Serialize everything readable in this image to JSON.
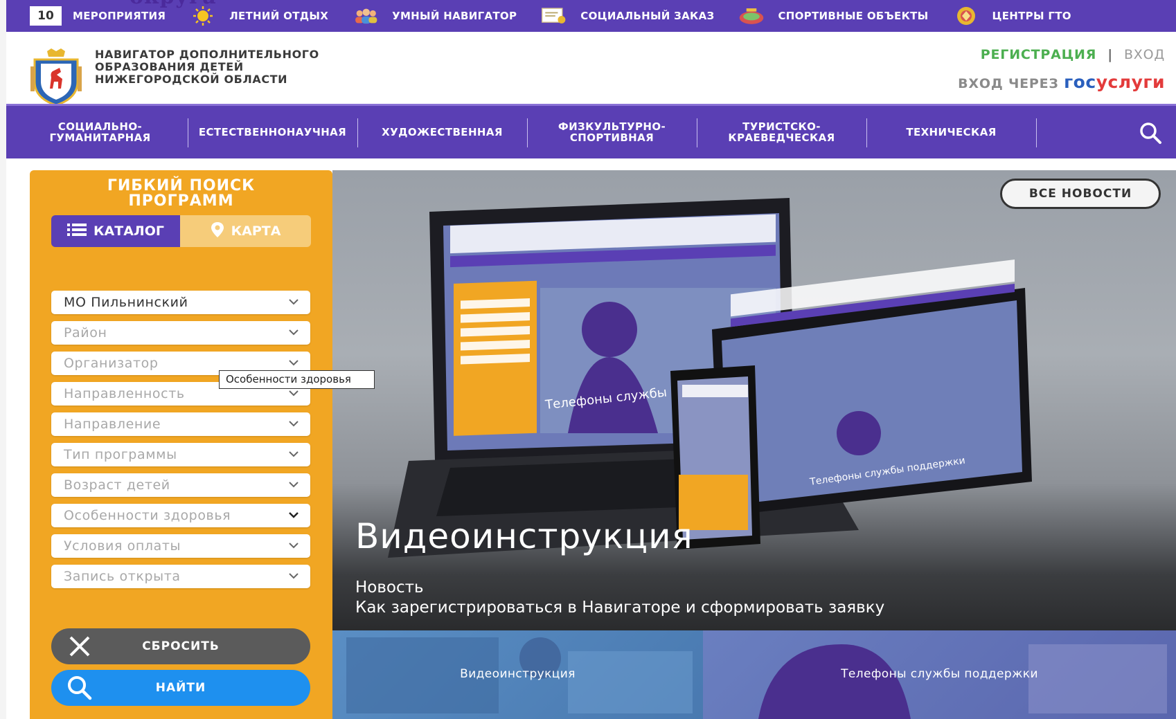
{
  "top_fragment": "округа",
  "topbar": {
    "badge": "10",
    "items": [
      {
        "label": "МЕРОПРИЯТИЯ",
        "icon": "none"
      },
      {
        "label": "ЛЕТНИЙ ОТДЫХ",
        "icon": "sun-icon"
      },
      {
        "label": "УМНЫЙ НАВИГАТОР",
        "icon": "people-icon"
      },
      {
        "label": "СОЦИАЛЬНЫЙ ЗАКАЗ",
        "icon": "certificate-icon"
      },
      {
        "label": "СПОРТИВНЫЕ ОБЪЕКТЫ",
        "icon": "stadium-icon"
      },
      {
        "label": "ЦЕНТРЫ ГТО",
        "icon": "gto-badge-icon"
      }
    ]
  },
  "header": {
    "brand_line1": "НАВИГАТОР ДОПОЛНИТЕЛЬНОГО",
    "brand_line2": "ОБРАЗОВАНИЯ ДЕТЕЙ",
    "brand_line3": "НИЖЕГОРОДСКОЙ ОБЛАСТИ",
    "register": "РЕГИСТРАЦИЯ",
    "separator": "|",
    "login": "ВХОД",
    "gos_prefix": "ВХОД ЧЕРЕЗ",
    "gos_part1": "гос",
    "gos_part2": "услуги"
  },
  "categories": [
    {
      "line1": "СОЦИАЛЬНО-",
      "line2": "ГУМАНИТАРНАЯ"
    },
    {
      "line1": "ЕСТЕСТВЕННОНАУЧНАЯ",
      "line2": ""
    },
    {
      "line1": "ХУДОЖЕСТВЕННАЯ",
      "line2": ""
    },
    {
      "line1": "ФИЗКУЛЬТУРНО-",
      "line2": "СПОРТИВНАЯ"
    },
    {
      "line1": "ТУРИСТСКО-",
      "line2": "КРАЕВЕДЧЕСКАЯ"
    },
    {
      "line1": "ТЕХНИЧЕСКАЯ",
      "line2": ""
    }
  ],
  "search_panel": {
    "title_line1": "ГИБКИЙ ПОИСК",
    "title_line2": "ПРОГРАММ",
    "catalog_label": "КАТАЛОГ",
    "map_label": "КАРТА",
    "filters": [
      {
        "value": "МО Пильнинский",
        "selected": true
      },
      {
        "value": "Район",
        "selected": false
      },
      {
        "value": "Организатор",
        "selected": false
      },
      {
        "value": "Направленность",
        "selected": false
      },
      {
        "value": "Направление",
        "selected": false
      },
      {
        "value": "Тип программы",
        "selected": false
      },
      {
        "value": "Возраст детей",
        "selected": false
      },
      {
        "value": "Особенности здоровья",
        "selected": false
      },
      {
        "value": "Условия оплаты",
        "selected": false
      },
      {
        "value": "Запись открыта",
        "selected": false
      }
    ],
    "tooltip": "Особенности здоровья",
    "reset_label": "СБРОСИТЬ",
    "find_label": "НАЙТИ"
  },
  "hero": {
    "all_news": "ВСЕ НОВОСТИ",
    "title": "Видеоинструкция",
    "kicker": "Новость",
    "description": "Как зарегистрироваться в Навигаторе и сформировать заявку",
    "screen_caption_1": "Телефоны службы по",
    "screen_caption_2": "Телефоны службы поддержки"
  },
  "thumbnails": [
    {
      "label": "Видеоинструкция"
    },
    {
      "label": "Телефоны службы поддержки"
    }
  ],
  "colors": {
    "brand_purple": "#5a3fb4",
    "panel_orange": "#f1a623",
    "register_green": "#4caf50",
    "find_blue": "#1e90ef",
    "reset_gray": "#5b5b5b"
  }
}
